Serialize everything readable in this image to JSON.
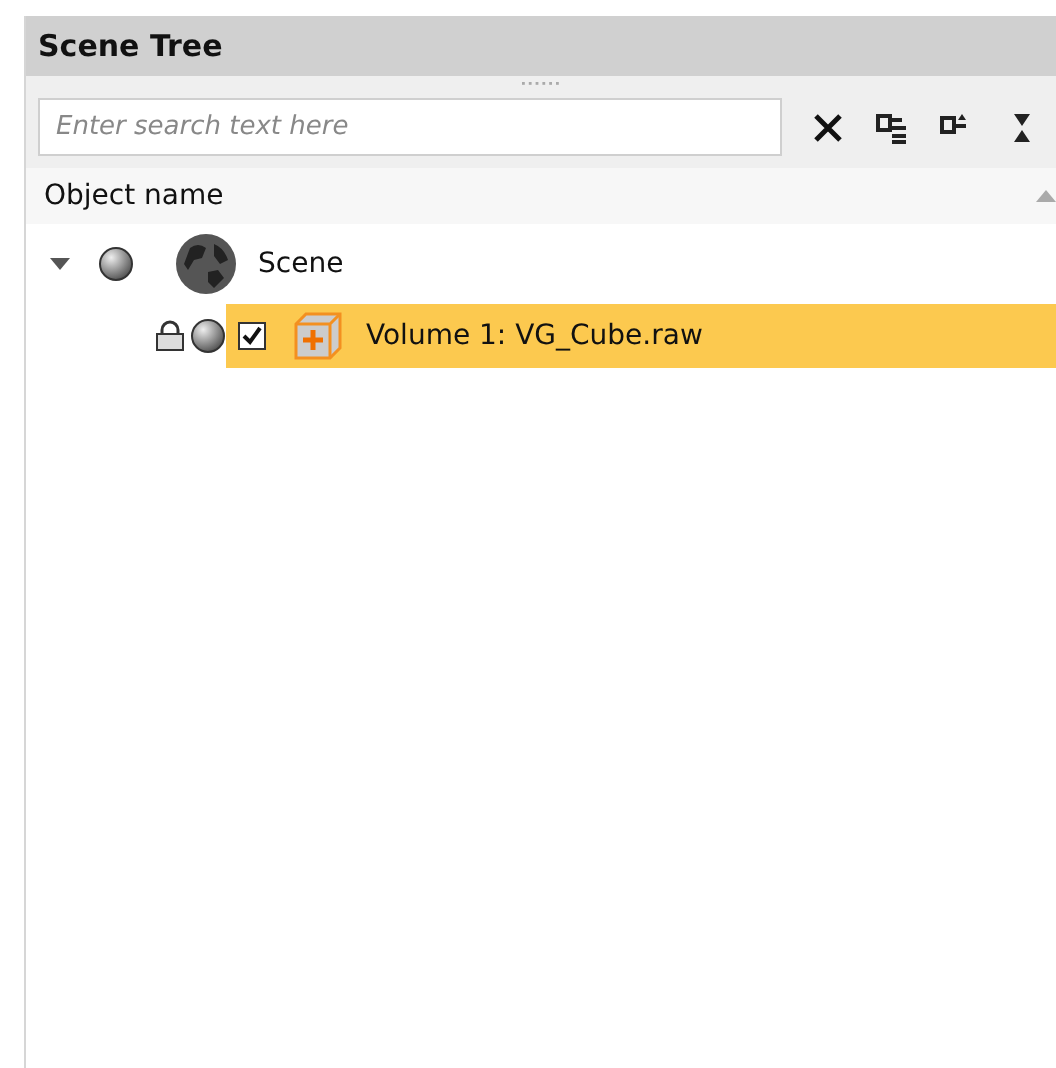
{
  "panel": {
    "title": "Scene Tree"
  },
  "search": {
    "placeholder": "Enter search text here"
  },
  "column": {
    "label": "Object name"
  },
  "tree": [
    {
      "kind": "scene",
      "label": "Scene",
      "expanded": true,
      "selected": false,
      "children": [
        {
          "kind": "volume",
          "label": "Volume 1: VG_Cube.raw",
          "selected": true,
          "locked": true,
          "checked": true
        }
      ]
    }
  ]
}
